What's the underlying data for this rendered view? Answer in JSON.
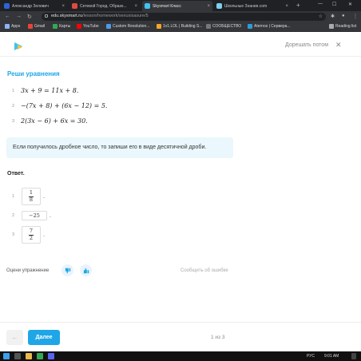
{
  "browser": {
    "tabs": [
      {
        "label": "Александр Зелевич",
        "color": "#2d63d8",
        "active": false
      },
      {
        "label": "Сетевой Город. Образо...",
        "color": "#e04a3f",
        "active": false
      },
      {
        "label": "Skysmart Класс",
        "color": "#42c2f0",
        "active": true
      },
      {
        "label": "Школьные Знания.com",
        "color": "#7bd0f0",
        "active": false
      }
    ],
    "url_host": "edu.skysmart.ru",
    "url_path": "/lesson/homework/sexuxisasure/5",
    "bookmarks": [
      {
        "label": "Apps",
        "color": "#8ab4f8"
      },
      {
        "label": "Gmail",
        "color": "#ea4335"
      },
      {
        "label": "Карты",
        "color": "#34a853"
      },
      {
        "label": "YouTube",
        "color": "#ff0000"
      },
      {
        "label": "Custom Resolution...",
        "color": "#4c9be8"
      },
      {
        "label": "1v1.LOL | Building S...",
        "color": "#f5a623"
      },
      {
        "label": "СООБЩЕСТВО",
        "color": "#777777"
      },
      {
        "label": "Aternos | Сервера...",
        "color": "#2e9bd6"
      },
      {
        "label": "Reading list",
        "color": "#aaaaaa"
      }
    ]
  },
  "header": {
    "finish_later": "Дорешать потом",
    "close_symbol": "✕"
  },
  "exercise": {
    "title": "Реши уравнения",
    "equations": [
      {
        "num": "1",
        "text": "3x + 9 = 11x + 8."
      },
      {
        "num": "2",
        "text": "−(7x + 8) + (6x − 12) = 5."
      },
      {
        "num": "3",
        "text": "2(3x − 6) + 6x = 30."
      }
    ],
    "hint": "Если получилось дробное число, то запиши его в виде десятичной дроби."
  },
  "answers": {
    "label": "Ответ.",
    "items": [
      {
        "num": "1",
        "numerator": "1",
        "denominator": "8",
        "suffix": "."
      },
      {
        "num": "2",
        "value": "−25",
        "suffix": "."
      },
      {
        "num": "3",
        "numerator": "7",
        "denominator": "2",
        "suffix": "."
      }
    ]
  },
  "rating": {
    "label": "Оцени упражнение",
    "report": "Сообщить об ошибке",
    "accent": "#1fa6e6"
  },
  "footer": {
    "back_symbol": "←",
    "next": "Далее",
    "pager": "1 из 3"
  },
  "taskbar": {
    "lang": "РУС",
    "time": "9:01 AM"
  }
}
